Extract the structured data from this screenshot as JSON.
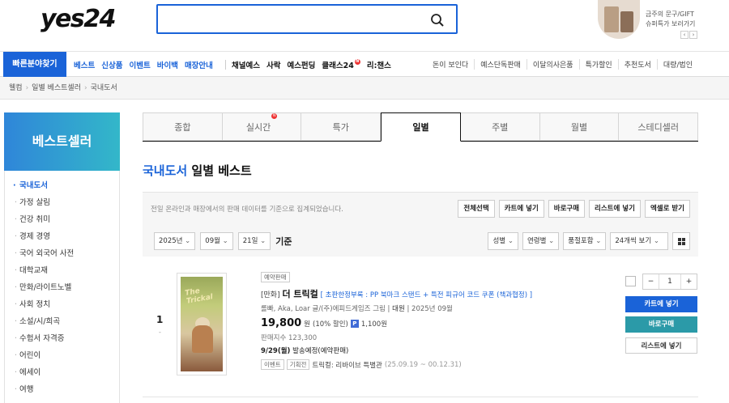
{
  "header": {
    "logo": "yes24",
    "search_placeholder": "",
    "promo_line1": "금주의 문구/GIFT",
    "promo_line2": "슈퍼특가 보러가기",
    "promo_prev": "‹",
    "promo_next": "›"
  },
  "nav": {
    "quick_label": "빠른분야찾기",
    "blue_items": [
      "베스트",
      "신상품",
      "이벤트",
      "바이백",
      "매장안내"
    ],
    "black_items": [
      "채널예스",
      "사락",
      "예스펀딩",
      "클래스24",
      "리:챈스"
    ],
    "new_badge": "N",
    "right_items": [
      "돈이 보인다",
      "예스단독판매",
      "이달의사은품",
      "특가할인",
      "추천도서",
      "대량/법인"
    ]
  },
  "breadcrumb": [
    "웰컴",
    "일별 베스트셀러",
    "국내도서"
  ],
  "sidebar": {
    "title": "베스트셀러",
    "items": [
      "국내도서",
      "가정 살림",
      "건강 취미",
      "경제 경영",
      "국어 외국어 사전",
      "대학교재",
      "만화/라이트노벨",
      "사회 정치",
      "소설/시/희곡",
      "수험서 자격증",
      "어린이",
      "에세이",
      "여행"
    ]
  },
  "tabs": [
    "종합",
    "실시간",
    "특가",
    "일별",
    "주별",
    "월별",
    "스테디셀러"
  ],
  "title": {
    "blue": "국내도서",
    "rest": " 일별 베스트"
  },
  "filter": {
    "note": "전일 온라인과 매장에서의 판매 데이터를 기준으로 집계되었습니다.",
    "buttons": [
      "전체선택",
      "카트에 넣기",
      "바로구매",
      "리스트에 넣기",
      "엑셀로 받기"
    ],
    "year": "2025년",
    "month": "09월",
    "day": "21일",
    "std": "기준",
    "options": [
      "성별",
      "연령별",
      "품절포함",
      "24개씩 보기"
    ]
  },
  "product": {
    "rank": "1",
    "rank_change": "-",
    "cover_text": "The Trickal",
    "badge": "예약판매",
    "category": "[만화]",
    "title": "더 트릭컬",
    "subtitle": "[ 초판한정부록 : PP 북마크 스탠드 + 특전 피규어 코드 쿠폰 (책과협정) ]",
    "author": "롤빠, Aka, Loar 글/(주)에피드게임즈 그림",
    "publisher": "대원",
    "date": "2025년 09월",
    "price": "19,800",
    "price_unit": "원",
    "discount": "(10% 할인)",
    "point_badge": "P",
    "point": "1,100원",
    "sales": "판매지수 123,300",
    "ship_date": "9/29(월)",
    "ship_text": " 발송예정(예약판매)",
    "event_tags": [
      "이벤트",
      "기획전"
    ],
    "event_text": "트릭컬: 리바이브 특별관",
    "event_period": "(25.09.19 ~ 00.12.31)"
  },
  "actions": {
    "qty_minus": "−",
    "qty": "1",
    "qty_plus": "+",
    "cart": "카트에 넣기",
    "buy": "바로구매",
    "list": "리스트에 넣기"
  },
  "colors": {
    "accent": "#1a63d8",
    "teal": "#2b9aa8"
  }
}
